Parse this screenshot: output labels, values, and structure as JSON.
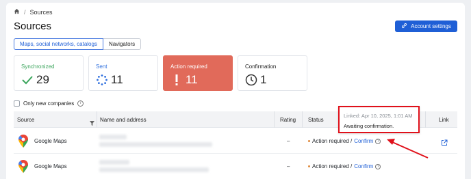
{
  "breadcrumb": {
    "home_icon": "home-icon",
    "current": "Sources"
  },
  "page": {
    "title": "Sources"
  },
  "account_button": {
    "label": "Account settings",
    "icon": "link-icon"
  },
  "tabs": [
    {
      "label": "Maps, social networks, catalogs",
      "active": true
    },
    {
      "label": "Navigators",
      "active": false
    }
  ],
  "stats": [
    {
      "label": "Synchronized",
      "value": "29",
      "icon": "check-icon",
      "color": "#3ba55c"
    },
    {
      "label": "Sent",
      "value": "11",
      "icon": "spinner-icon",
      "color": "#2f6fde"
    },
    {
      "label": "Action required",
      "value": "11",
      "icon": "exclamation-icon",
      "color": "#e16a5a"
    },
    {
      "label": "Confirmation",
      "value": "1",
      "icon": "clock-icon",
      "color": "#222222"
    }
  ],
  "filter": {
    "label": "Only new companies"
  },
  "table": {
    "headers": {
      "source": "Source",
      "name": "Name and address",
      "rating": "Rating",
      "status": "Status",
      "link": "Link"
    },
    "rows": [
      {
        "source": "Google Maps",
        "rating": "–",
        "status": "Action required /",
        "action": "Confirm",
        "has_link": true
      },
      {
        "source": "Google Maps",
        "rating": "–",
        "status": "Action required /",
        "action": "Confirm",
        "has_link": false
      }
    ]
  },
  "tooltip": {
    "linked": "Linked: Apr 10, 2025, 1:01 AM",
    "message": "Awaiting confirmation."
  },
  "colors": {
    "accent": "#1f5fd6",
    "alert": "#e16a5a",
    "highlight": "#e0101a"
  }
}
